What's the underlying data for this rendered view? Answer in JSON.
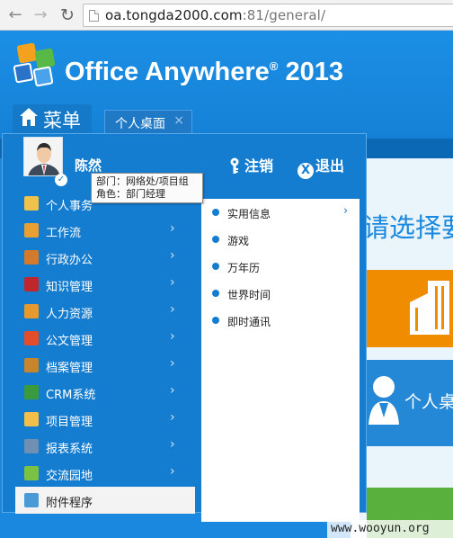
{
  "browser": {
    "url_host": "oa.tongda2000.com",
    "url_port": ":81",
    "url_path": "/general/"
  },
  "header": {
    "app_name": "Office Anywhere",
    "registered_mark": "®",
    "app_year": "2013",
    "menu_label": "菜单",
    "tab_label": "个人桌面",
    "tab_close": "×"
  },
  "start_menu": {
    "user_name": "陈然",
    "logout_label": "注销",
    "exit_label": "退出",
    "tooltip": {
      "dept": "部门：网络处/项目组",
      "role": "角色：部门经理"
    },
    "items": [
      {
        "label": "个人事务",
        "icon": "people-icon",
        "color": "#f0c24a",
        "arrow": ""
      },
      {
        "label": "工作流",
        "icon": "workflow-icon",
        "color": "#e8a033",
        "arrow": "›"
      },
      {
        "label": "行政办公",
        "icon": "office-building-icon",
        "color": "#d47a2b",
        "arrow": "›"
      },
      {
        "label": "知识管理",
        "icon": "book-icon",
        "color": "#c0272d",
        "arrow": "›"
      },
      {
        "label": "人力资源",
        "icon": "hr-icon",
        "color": "#e69a2e",
        "arrow": "›"
      },
      {
        "label": "公文管理",
        "icon": "document-icon",
        "color": "#e44d2a",
        "arrow": "›"
      },
      {
        "label": "档案管理",
        "icon": "archive-box-icon",
        "color": "#c8862b",
        "arrow": "›"
      },
      {
        "label": "CRM系统",
        "icon": "crm-icon",
        "color": "#3a9b3e",
        "arrow": "›"
      },
      {
        "label": "项目管理",
        "icon": "project-icon",
        "color": "#f2c04a",
        "arrow": "›"
      },
      {
        "label": "报表系统",
        "icon": "report-icon",
        "color": "#6f8fb3",
        "arrow": "›"
      },
      {
        "label": "交流园地",
        "icon": "chat-icon",
        "color": "#7bc143",
        "arrow": "›"
      },
      {
        "label": "附件程序",
        "icon": "gear-icon",
        "color": "#4a9ad8",
        "arrow": ""
      }
    ],
    "submenu": [
      {
        "label": "实用信息",
        "arrow": "›"
      },
      {
        "label": "游戏",
        "arrow": ""
      },
      {
        "label": "万年历",
        "arrow": ""
      },
      {
        "label": "世界时间",
        "arrow": ""
      },
      {
        "label": "即时通讯",
        "arrow": ""
      }
    ]
  },
  "workspace": {
    "select_heading": "请选择要",
    "tile_label": "个人桌"
  },
  "watermark": "www.wooyun.org",
  "colors": {
    "brand_blue": "#1a88de",
    "menu_blue": "#157dd0",
    "tile_orange": "#f08c00",
    "tile_green": "#59b03c"
  }
}
